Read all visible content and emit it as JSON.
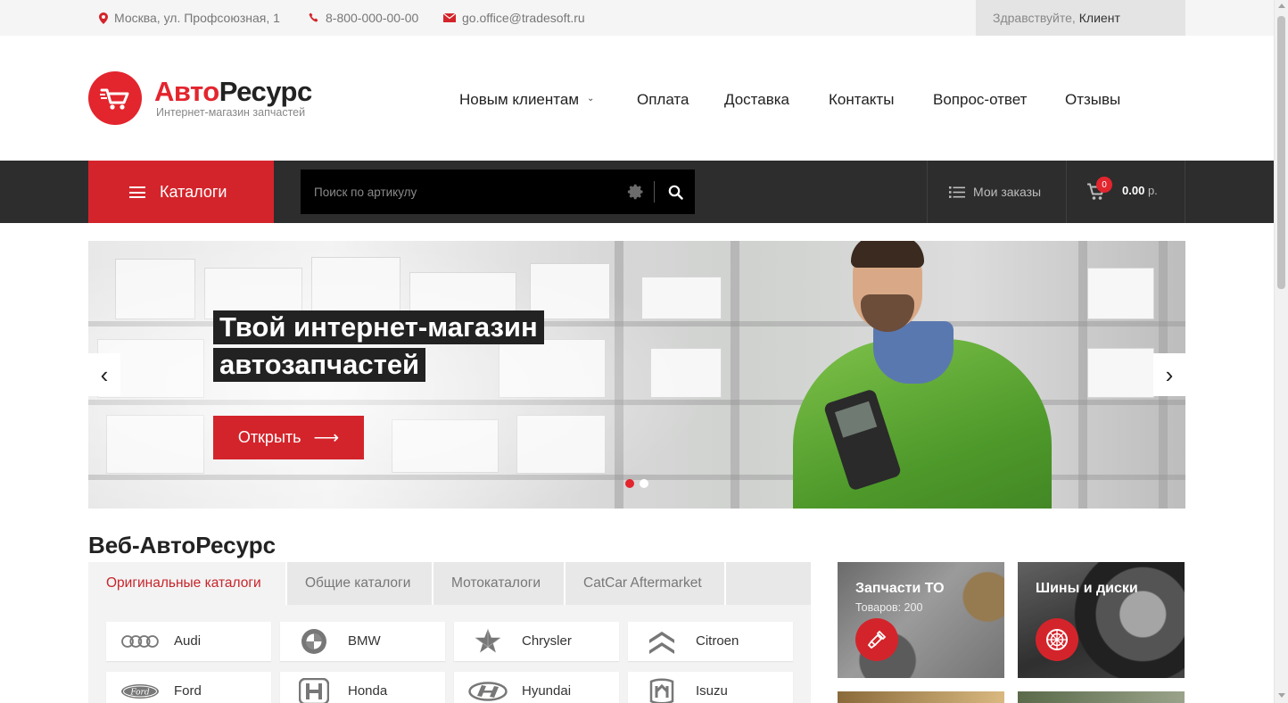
{
  "topbar": {
    "address": "Москва, ул. Профсоюзная, 1",
    "phone": "8-800-000-00-00",
    "email": "go.office@tradesoft.ru",
    "greeting": "Здравствуйте,",
    "user": "Клиент"
  },
  "logo": {
    "name_part1": "Авто",
    "name_part2": "Ресурс",
    "tagline": "Интернет-магазин запчастей"
  },
  "nav": [
    {
      "label": "Новым клиентам",
      "has_dropdown": true
    },
    {
      "label": "Оплата"
    },
    {
      "label": "Доставка"
    },
    {
      "label": "Контакты"
    },
    {
      "label": "Вопрос-ответ"
    },
    {
      "label": "Отзывы"
    }
  ],
  "toolbar": {
    "catalogs_label": "Каталоги",
    "search_placeholder": "Поиск по артикулу",
    "orders_label": "Мои заказы",
    "cart_count": "0",
    "cart_sum": "0.00",
    "cart_currency": "р."
  },
  "hero": {
    "title_line1": "Твой интернет-магазин",
    "title_line2": "автозапчастей",
    "button_label": "Открыть",
    "button_arrow": "⟶",
    "prev_arrow": "‹",
    "next_arrow": "›",
    "slides_total": 2,
    "active_slide": 1
  },
  "section": {
    "title": "Веб-АвтоРесурс",
    "tabs": [
      "Оригинальные каталоги",
      "Общие каталоги",
      "Мотокаталоги",
      "CatCar Aftermarket"
    ],
    "active_tab": 0,
    "brands": [
      "Audi",
      "BMW",
      "Chrysler",
      "Citroen",
      "Ford",
      "Honda",
      "Hyundai",
      "Isuzu"
    ]
  },
  "promos": [
    {
      "title": "Запчасти ТО",
      "subtitle": "Товаров: 200",
      "icon": "spark-plug-icon"
    },
    {
      "title": "Шины и диски",
      "subtitle": "",
      "icon": "wheel-icon"
    }
  ],
  "colors": {
    "accent": "#d4242b",
    "dark_bar": "#2d2d2d",
    "topbar_bg": "#f5f5f5"
  }
}
